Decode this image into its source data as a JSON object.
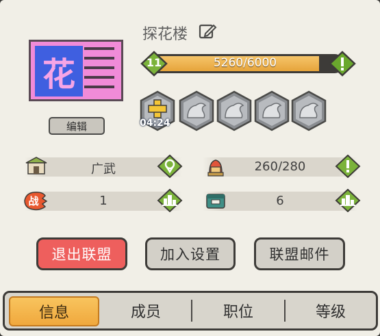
{
  "profile": {
    "flag_char": "花",
    "edit_label": "编辑",
    "name": "探花楼"
  },
  "level": {
    "value": "11",
    "progress_text": "5260/6000",
    "progress": 0.877
  },
  "slots": {
    "timer": "04:24"
  },
  "stats": {
    "location": "广武",
    "capacity": "260/280",
    "battle": "1",
    "rank": "6"
  },
  "buttons": {
    "leave": "退出联盟",
    "join_settings": "加入设置",
    "mail": "联盟邮件"
  },
  "tabs": [
    "信息",
    "成员",
    "职位",
    "等级"
  ],
  "colors": {
    "accent_orange": "#f0a83d",
    "danger_red": "#ee5f5d",
    "level_green": "#7bb33a",
    "flag_pink": "#f08bd8",
    "flag_blue": "#3f5fe0"
  },
  "icons": {
    "name_edit": "edit-icon",
    "alert": "alert-icon",
    "location": "location-pin-icon",
    "ranking": "podium-icon",
    "building": "building-icon",
    "warrior": "warrior-helmet-icon",
    "battle": "battle-icon",
    "chest": "chest-icon",
    "add_slot": "plus-icon",
    "locked_slot": "dragon-statue-icon"
  }
}
